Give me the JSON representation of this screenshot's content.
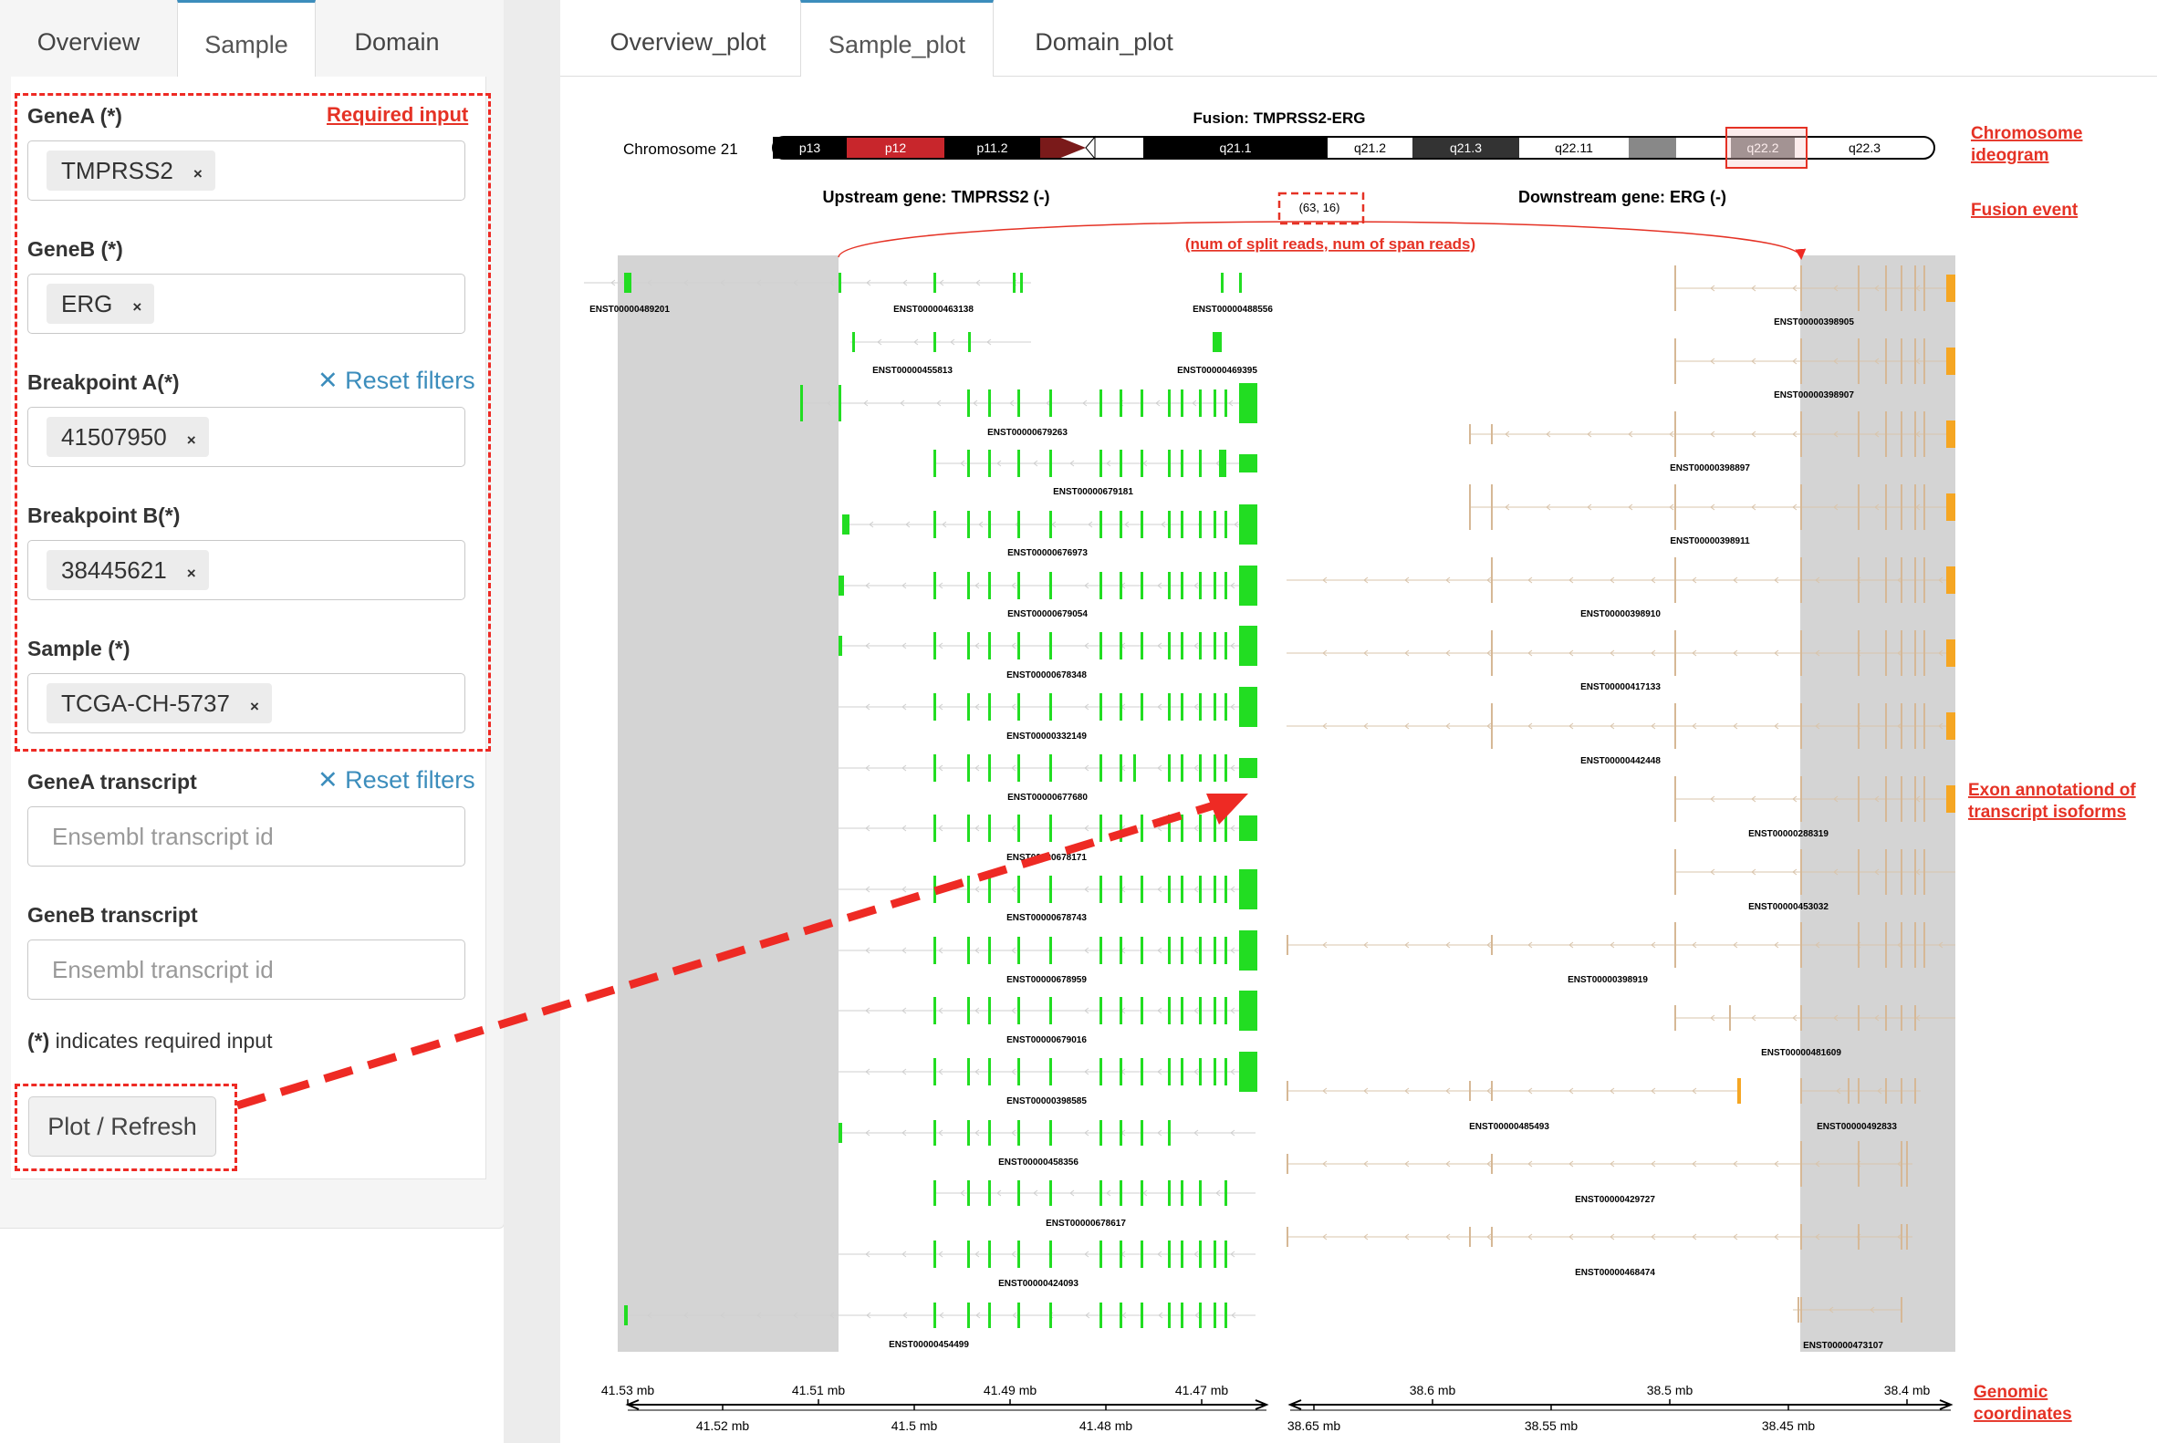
{
  "left_tabs": [
    {
      "label": "Overview"
    },
    {
      "label": "Sample"
    },
    {
      "label": "Domain"
    }
  ],
  "right_tabs": [
    {
      "label": "Overview_plot"
    },
    {
      "label": "Sample_plot"
    },
    {
      "label": "Domain_plot"
    }
  ],
  "form": {
    "required_input_label": "Required input",
    "reset_filters_label": "Reset filters",
    "geneA": {
      "label": "GeneA (*)",
      "value": "TMPRSS2"
    },
    "geneB": {
      "label": "GeneB (*)",
      "value": "ERG"
    },
    "breakpointA": {
      "label": "Breakpoint A(*)",
      "value": "41507950"
    },
    "breakpointB": {
      "label": "Breakpoint B(*)",
      "value": "38445621"
    },
    "sample": {
      "label": "Sample (*)",
      "value": "TCGA-CH-5737"
    },
    "geneA_transcript": {
      "label": "GeneA transcript",
      "placeholder": "Ensembl transcript id"
    },
    "geneB_transcript": {
      "label": "GeneB transcript",
      "placeholder": "Ensembl transcript id"
    },
    "required_note_mark": "(*)",
    "required_note_text": " indicates required input",
    "plot_button": "Plot / Refresh",
    "chip_remove": "×"
  },
  "plot": {
    "title": "Fusion: TMPRSS2-ERG",
    "chromosome_label": "Chromosome 21",
    "bands": [
      "p13",
      "p12",
      "p11.2",
      "q21.1",
      "q21.2",
      "q21.3",
      "q22.11",
      "q22.2",
      "q22.3"
    ],
    "upstream_label": "Upstream gene: TMPRSS2 (-)",
    "downstream_label": "Downstream gene: ERG (-)",
    "fusion_reads": "(63, 16)",
    "reads_caption": "(num of split reads, num of span reads)",
    "left_transcripts": [
      "ENST00000489201",
      "ENST00000463138",
      "ENST00000488556",
      "ENST00000455813",
      "ENST00000469395",
      "ENST00000679263",
      "ENST00000679181",
      "ENST00000676973",
      "ENST00000679054",
      "ENST00000678348",
      "ENST00000332149",
      "ENST00000677680",
      "ENST00000678171",
      "ENST00000678743",
      "ENST00000678959",
      "ENST00000679016",
      "ENST00000398585",
      "ENST00000458356",
      "ENST00000678617",
      "ENST00000424093",
      "ENST00000454499"
    ],
    "right_transcripts": [
      "ENST00000398905",
      "ENST00000398907",
      "ENST00000398897",
      "ENST00000398911",
      "ENST00000398910",
      "ENST00000417133",
      "ENST00000442448",
      "ENST00000288319",
      "ENST00000453032",
      "ENST00000398919",
      "ENST00000481609",
      "ENST00000485493",
      "ENST00000492833",
      "ENST00000429727",
      "ENST00000468474",
      "ENST00000473107"
    ],
    "left_axis_top": [
      "41.53 mb",
      "41.51 mb",
      "41.49 mb",
      "41.47 mb"
    ],
    "left_axis_bottom": [
      "41.52 mb",
      "41.5 mb",
      "41.48 mb"
    ],
    "right_axis_top": [
      "38.6 mb",
      "38.5 mb",
      "38.4 mb"
    ],
    "right_axis_bottom": [
      "38.65 mb",
      "38.55 mb",
      "38.45 mb"
    ],
    "colors": {
      "upstream": "#22dd22",
      "downstream": "#f5a623",
      "annotation": "#e53225",
      "ideogram_highlight": "#f7c9c9"
    }
  },
  "annotations": {
    "chromosome_ideogram": "Chromosome ideogram",
    "fusion_event": "Fusion event",
    "exon_annotation": "Exon annotationd of transcript isoforms",
    "genomic_coordinates": "Genomic coordinates"
  }
}
